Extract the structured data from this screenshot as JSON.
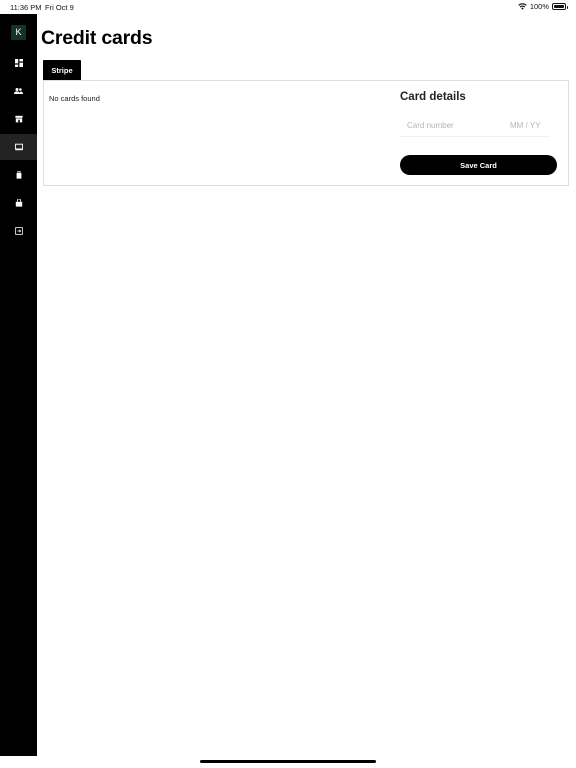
{
  "status_bar": {
    "time": "11:36 PM",
    "date": "Fri Oct 9",
    "battery": "100%",
    "wifi_icon": "wifi-icon",
    "battery_icon": "battery-icon"
  },
  "sidebar": {
    "logo_letter": "K",
    "logo_color": "#163327",
    "items": [
      {
        "icon": "dashboard-icon"
      },
      {
        "icon": "users-icon"
      },
      {
        "icon": "store-icon"
      },
      {
        "icon": "credit-card-icon",
        "active": true
      },
      {
        "icon": "receipt-icon"
      },
      {
        "icon": "shopping-bag-icon"
      },
      {
        "icon": "logout-icon"
      }
    ]
  },
  "page": {
    "title": "Credit cards"
  },
  "tabs": [
    {
      "label": "Stripe",
      "active": true
    }
  ],
  "cards_list": {
    "empty_text": "No cards found"
  },
  "card_form": {
    "title": "Card details",
    "card_number_placeholder": "Card number",
    "expiry_placeholder": "MM / YY",
    "save_label": "Save Card"
  },
  "colors": {
    "sidebar_bg": "#000000",
    "accent": "#000000",
    "placeholder": "#b5b5b5"
  }
}
